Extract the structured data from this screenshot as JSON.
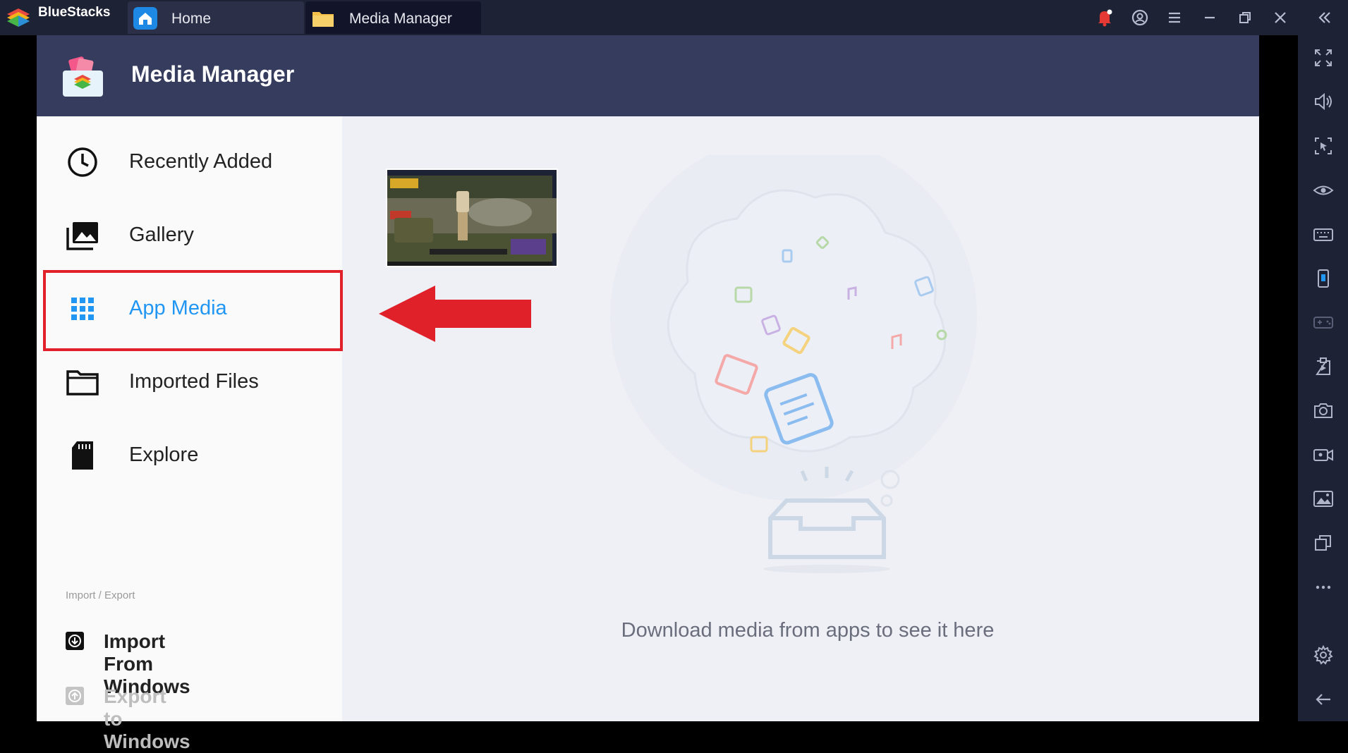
{
  "app": {
    "name": "BlueStacks"
  },
  "tabs": [
    {
      "label": "Home"
    },
    {
      "label": "Media Manager"
    }
  ],
  "header": {
    "title": "Media Manager"
  },
  "sidebar": {
    "items": [
      {
        "label": "Recently Added",
        "icon": "clock-icon"
      },
      {
        "label": "Gallery",
        "icon": "gallery-icon"
      },
      {
        "label": "App Media",
        "icon": "grid-icon",
        "active": true
      },
      {
        "label": "Imported Files",
        "icon": "folder-icon"
      },
      {
        "label": "Explore",
        "icon": "sd-card-icon"
      }
    ],
    "import_export_caption": "Import / Export",
    "import_label": "Import From Windows",
    "export_label": "Export to Windows"
  },
  "content": {
    "empty_message": "Download media from apps to see it here"
  },
  "colors": {
    "titlebar": "#1e2235",
    "header": "#353c5e",
    "accent": "#2196f3",
    "highlight": "#e0212a"
  }
}
